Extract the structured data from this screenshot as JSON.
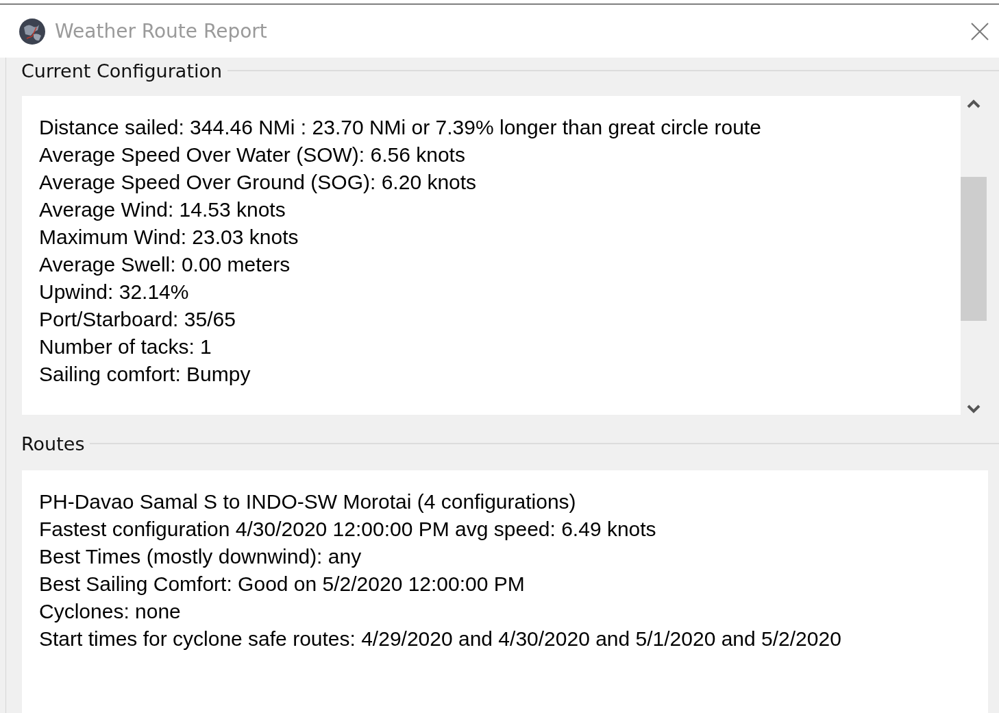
{
  "window": {
    "title": "Weather Route Report"
  },
  "current_configuration": {
    "title": "Current Configuration",
    "lines": [
      "Distance sailed: 344.46 NMi : 23.70 NMi or 7.39% longer than great circle route",
      "Average Speed Over Water (SOW): 6.56 knots",
      "Average Speed Over Ground (SOG): 6.20 knots",
      "Average Wind: 14.53 knots",
      "Maximum Wind: 23.03 knots",
      "Average Swell: 0.00 meters",
      "Upwind: 32.14%",
      "Port/Starboard: 35/65",
      "Number of tacks: 1",
      "Sailing comfort: Bumpy"
    ]
  },
  "routes": {
    "title": "Routes",
    "lines": [
      "PH-Davao Samal S to INDO-SW Morotai (4 configurations)",
      "Fastest configuration 4/30/2020 12:00:00 PM avg speed: 6.49 knots",
      "Best Times (mostly downwind): any",
      "Best Sailing Comfort: Good on 5/2/2020 12:00:00 PM",
      "Cyclones: none",
      "Start times for cyclone safe routes: 4/29/2020 and 4/30/2020 and 5/1/2020 and 5/2/2020"
    ]
  }
}
